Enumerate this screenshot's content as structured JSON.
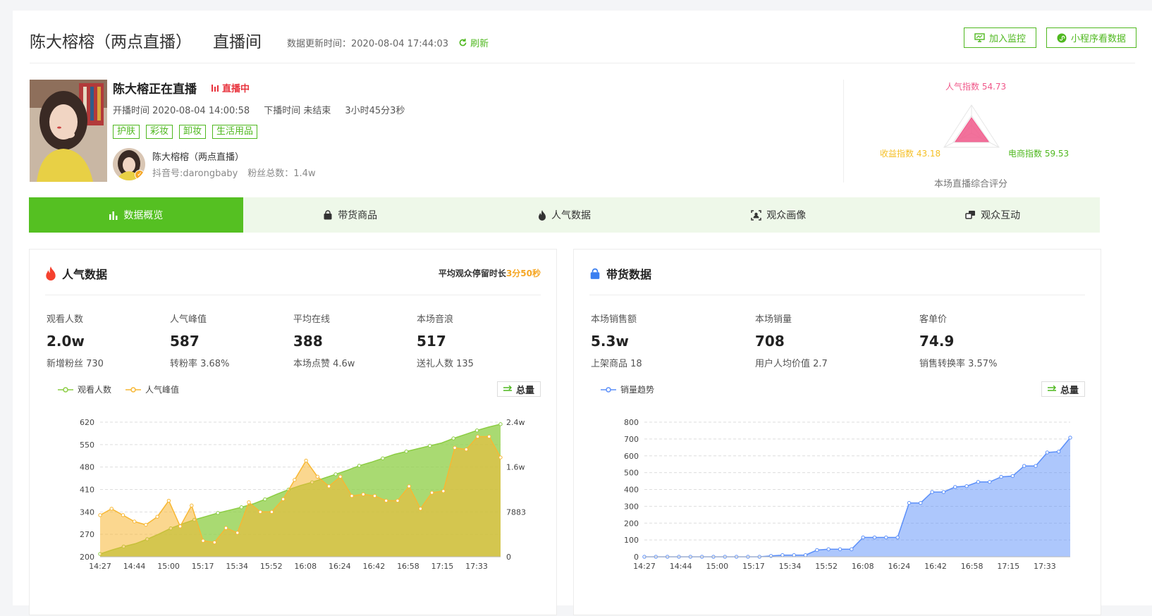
{
  "header": {
    "title": "陈大榕榕（两点直播）",
    "room": "直播间",
    "update_label": "数据更新时间：2020-08-04 17:44:03",
    "refresh": "刷新",
    "btn_monitor": "加入监控",
    "btn_miniapp": "小程序看数据"
  },
  "live": {
    "title": "陈大榕正在直播",
    "status": "直播中",
    "start": "开播时间 2020-08-04 14:00:58",
    "end": "下播时间 未结束",
    "duration": "3小时45分3秒",
    "tags": [
      "护肤",
      "彩妆",
      "卸妆",
      "生活用品"
    ],
    "owner_name": "陈大榕榕（两点直播）",
    "owner_id": "抖音号:darongbaby",
    "owner_fans": "粉丝总数：1.4w"
  },
  "score": {
    "popularity": "人气指数 54.73",
    "revenue": "收益指数 43.18",
    "ecommerce": "电商指数 59.53",
    "caption": "本场直播综合评分",
    "values": {
      "popularity": 54.73,
      "revenue": 43.18,
      "ecommerce": 59.53
    },
    "colors": {
      "popularity": "#f0588a",
      "revenue": "#f5c026",
      "ecommerce": "#4fb81f"
    }
  },
  "tabs": [
    "数据概览",
    "带货商品",
    "人气数据",
    "观众画像",
    "观众互动"
  ],
  "pop": {
    "title": "人气数据",
    "extra_label": "平均观众停留时长",
    "extra_value": "3分50秒",
    "stats": [
      {
        "label": "观看人数",
        "value": "2.0w",
        "sub": "新增粉丝 730"
      },
      {
        "label": "人气峰值",
        "value": "587",
        "sub": "转粉率 3.68%"
      },
      {
        "label": "平均在线",
        "value": "388",
        "sub": "本场点赞 4.6w"
      },
      {
        "label": "本场音浪",
        "value": "517",
        "sub": "送礼人数 135"
      }
    ],
    "legend": [
      "观看人数",
      "人气峰值"
    ],
    "total": "总量"
  },
  "sales": {
    "title": "带货数据",
    "stats": [
      {
        "label": "本场销售额",
        "value": "5.3w",
        "sub": "上架商品 18"
      },
      {
        "label": "本场销量",
        "value": "708",
        "sub": "用户人均价值 2.7"
      },
      {
        "label": "客单价",
        "value": "74.9",
        "sub": "销售转换率 3.57%"
      }
    ],
    "legend": [
      "销量趋势"
    ],
    "total": "总量"
  },
  "chart_data": [
    {
      "type": "area",
      "x_ticks": [
        "14:27",
        "14:44",
        "15:00",
        "15:17",
        "15:34",
        "15:52",
        "16:08",
        "16:24",
        "16:42",
        "16:58",
        "17:15",
        "17:33"
      ],
      "y_left_ticks": [
        200,
        270,
        340,
        410,
        480,
        550,
        620
      ],
      "y_right_ticks": [
        "0",
        "7883",
        "1.6w",
        "2.4w"
      ],
      "ylim_left": [
        200,
        620
      ],
      "ylim_right": [
        0,
        23649
      ],
      "series": [
        {
          "name": "观看人数",
          "axis": "right",
          "color": "#8ccd43",
          "values": [
            500,
            1200,
            1800,
            2300,
            3100,
            4000,
            5000,
            5800,
            6500,
            7100,
            7700,
            8200,
            8700,
            9300,
            10100,
            11000,
            11800,
            12500,
            13100,
            13800,
            14500,
            15200,
            16000,
            16600,
            17300,
            18000,
            18500,
            19000,
            19500,
            20000,
            20800,
            21500,
            22200,
            22800,
            23300
          ]
        },
        {
          "name": "人气峰值",
          "axis": "left",
          "color": "#f7b733",
          "values": [
            330,
            350,
            330,
            310,
            300,
            325,
            375,
            295,
            360,
            250,
            245,
            290,
            275,
            370,
            340,
            340,
            380,
            440,
            500,
            450,
            420,
            450,
            390,
            395,
            390,
            375,
            375,
            420,
            350,
            400,
            405,
            540,
            535,
            575,
            575,
            510
          ]
        }
      ],
      "grid": true
    },
    {
      "type": "area",
      "x_ticks": [
        "14:27",
        "14:44",
        "15:00",
        "15:17",
        "15:34",
        "15:52",
        "16:08",
        "16:24",
        "16:42",
        "16:58",
        "17:15",
        "17:33"
      ],
      "y_ticks": [
        0,
        100,
        200,
        300,
        400,
        500,
        600,
        700,
        800
      ],
      "ylim": [
        0,
        800
      ],
      "series": [
        {
          "name": "销量趋势",
          "color": "#5b8ff9",
          "values": [
            0,
            0,
            0,
            0,
            0,
            0,
            0,
            0,
            0,
            0,
            0,
            5,
            10,
            10,
            10,
            40,
            45,
            45,
            45,
            115,
            115,
            115,
            115,
            320,
            320,
            385,
            385,
            415,
            420,
            445,
            445,
            475,
            480,
            540,
            540,
            620,
            625,
            708
          ]
        }
      ],
      "grid": true
    }
  ]
}
